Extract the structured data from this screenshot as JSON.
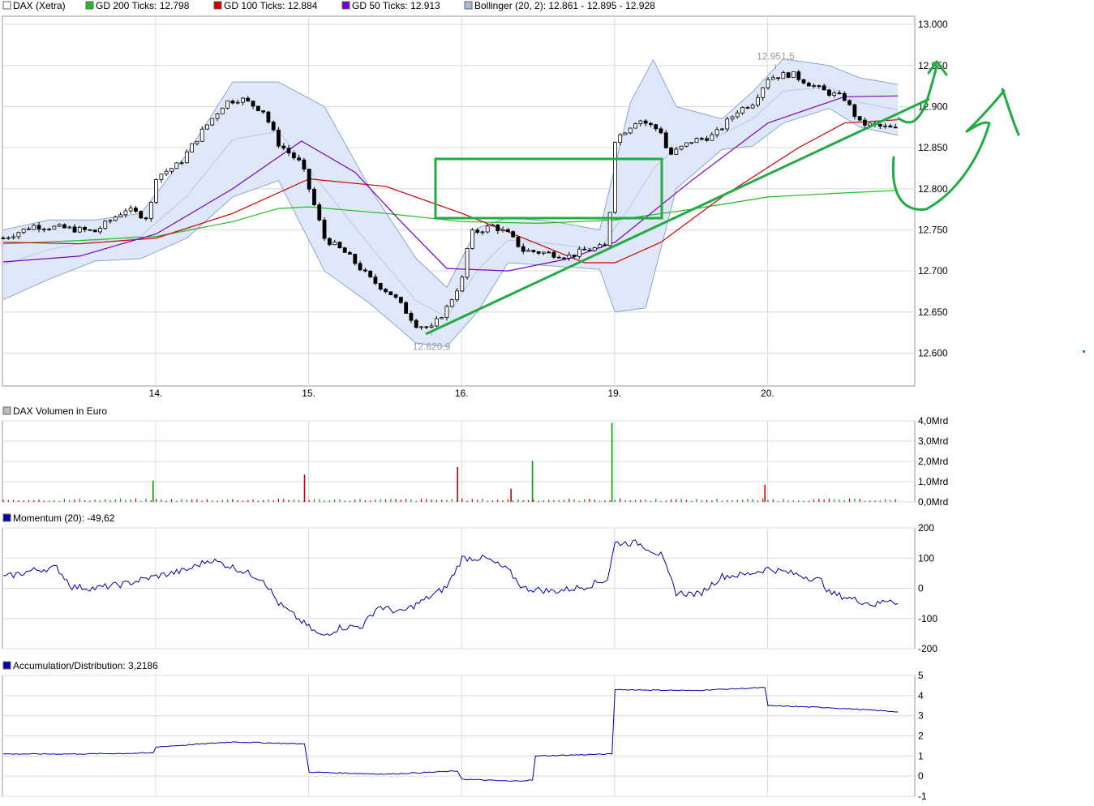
{
  "colors": {
    "up": "#00a000",
    "down": "#cc0000",
    "gd200": "#22bb22",
    "gd100": "#cc0000",
    "gd50": "#7a00cc",
    "boll_fill": "#dfe8f8",
    "boll_edge": "#8aa6d0",
    "momentum": "#0000aa",
    "ad": "#0000aa",
    "drawing": "#22aa44",
    "grid": "#dcdcdc"
  },
  "panels": {
    "price": {
      "legend": [
        {
          "label": "DAX (Xetra)",
          "color": "#ffffff"
        },
        {
          "label": "GD 200 Ticks: 12.798",
          "color": "#22bb22"
        },
        {
          "label": "GD 100 Ticks: 12.884",
          "color": "#cc0000"
        },
        {
          "label": "GD 50 Ticks: 12.913",
          "color": "#7a00cc"
        },
        {
          "label": "Bollinger (20, 2): 12.861 - 12.895 - 12.928",
          "color": "#a8bbdd"
        }
      ],
      "yticks": [
        "13.000",
        "12.950",
        "12.900",
        "12.850",
        "12.800",
        "12.750",
        "12.700",
        "12.650",
        "12.600"
      ],
      "xticks": [
        "14.",
        "15.",
        "16.",
        "19.",
        "20."
      ],
      "annotations": {
        "high": "12.951,5",
        "low": "12.620,9"
      }
    },
    "volume": {
      "legend": {
        "label": "DAX Volumen in Euro",
        "color": "#bbbbbb"
      },
      "yticks": [
        "4,0Mrd",
        "3,0Mrd",
        "2,0Mrd",
        "1,0Mrd",
        "0,0Mrd"
      ]
    },
    "momentum": {
      "legend": {
        "label": "Momentum (20): -49,62",
        "color": "#0000aa"
      },
      "yticks": [
        "200",
        "100",
        "0",
        "-100",
        "-200"
      ]
    },
    "ad": {
      "legend": {
        "label": "Accumulation/Distribution: 3,2186",
        "color": "#0000aa"
      },
      "yticks": [
        "5",
        "4",
        "3",
        "2",
        "1",
        "0",
        "-1"
      ]
    }
  },
  "chart_data": [
    {
      "type": "candlestick",
      "title": "DAX (Xetra)",
      "ylim": [
        12560,
        13010
      ],
      "x_days": [
        "14.",
        "15.",
        "16.",
        "19.",
        "20."
      ],
      "x_range": [
        0,
        6.0
      ],
      "close_path": [
        [
          0,
          12740
        ],
        [
          0.2,
          12755
        ],
        [
          0.4,
          12752
        ],
        [
          0.6,
          12748
        ],
        [
          0.8,
          12775
        ],
        [
          0.95,
          12765
        ],
        [
          1.0,
          12815
        ],
        [
          1.15,
          12830
        ],
        [
          1.3,
          12870
        ],
        [
          1.45,
          12905
        ],
        [
          1.55,
          12910
        ],
        [
          1.7,
          12895
        ],
        [
          1.8,
          12855
        ],
        [
          1.95,
          12830
        ],
        [
          2.0,
          12800
        ],
        [
          2.1,
          12740
        ],
        [
          2.25,
          12720
        ],
        [
          2.4,
          12690
        ],
        [
          2.55,
          12670
        ],
        [
          2.7,
          12635
        ],
        [
          2.8,
          12630
        ],
        [
          2.9,
          12655
        ],
        [
          3.0,
          12690
        ],
        [
          3.05,
          12745
        ],
        [
          3.2,
          12755
        ],
        [
          3.3,
          12745
        ],
        [
          3.4,
          12725
        ],
        [
          3.55,
          12722
        ],
        [
          3.7,
          12718
        ],
        [
          3.8,
          12725
        ],
        [
          3.95,
          12730
        ],
        [
          4.0,
          12860
        ],
        [
          4.15,
          12885
        ],
        [
          4.3,
          12870
        ],
        [
          4.35,
          12840
        ],
        [
          4.5,
          12858
        ],
        [
          4.65,
          12865
        ],
        [
          4.8,
          12895
        ],
        [
          4.9,
          12905
        ],
        [
          5.0,
          12935
        ],
        [
          5.15,
          12940
        ],
        [
          5.35,
          12920
        ],
        [
          5.5,
          12910
        ],
        [
          5.6,
          12880
        ],
        [
          5.75,
          12875
        ],
        [
          5.85,
          12872
        ]
      ],
      "annotations": [
        {
          "label": "12.951,5",
          "x": 5.05,
          "y": 12951.5
        },
        {
          "label": "12.620,9",
          "x": 2.8,
          "y": 12620.9
        }
      ],
      "gd200": [
        [
          0,
          12733
        ],
        [
          0.5,
          12737
        ],
        [
          1.0,
          12742
        ],
        [
          1.5,
          12760
        ],
        [
          1.8,
          12776
        ],
        [
          2.0,
          12778
        ],
        [
          2.5,
          12770
        ],
        [
          3.0,
          12760
        ],
        [
          3.5,
          12758
        ],
        [
          4.0,
          12762
        ],
        [
          4.5,
          12775
        ],
        [
          5.0,
          12790
        ],
        [
          5.5,
          12795
        ],
        [
          5.85,
          12798
        ]
      ],
      "gd100": [
        [
          0,
          12735
        ],
        [
          0.5,
          12733
        ],
        [
          1.0,
          12740
        ],
        [
          1.5,
          12770
        ],
        [
          2.0,
          12812
        ],
        [
          2.5,
          12803
        ],
        [
          3.0,
          12770
        ],
        [
          3.4,
          12740
        ],
        [
          3.8,
          12710
        ],
        [
          4.0,
          12710
        ],
        [
          4.3,
          12735
        ],
        [
          4.7,
          12790
        ],
        [
          5.2,
          12850
        ],
        [
          5.5,
          12880
        ],
        [
          5.85,
          12884
        ]
      ],
      "gd50": [
        [
          0,
          12711
        ],
        [
          0.5,
          12718
        ],
        [
          1.0,
          12745
        ],
        [
          1.5,
          12800
        ],
        [
          1.95,
          12858
        ],
        [
          2.3,
          12820
        ],
        [
          2.6,
          12760
        ],
        [
          2.9,
          12703
        ],
        [
          3.3,
          12700
        ],
        [
          3.7,
          12715
        ],
        [
          4.0,
          12735
        ],
        [
          4.5,
          12810
        ],
        [
          5.0,
          12880
        ],
        [
          5.5,
          12912
        ],
        [
          5.85,
          12913
        ]
      ],
      "bollinger_upper": [
        [
          0,
          12750
        ],
        [
          0.3,
          12762
        ],
        [
          0.6,
          12762
        ],
        [
          0.9,
          12770
        ],
        [
          1.2,
          12842
        ],
        [
          1.5,
          12930
        ],
        [
          1.8,
          12930
        ],
        [
          2.1,
          12900
        ],
        [
          2.4,
          12800
        ],
        [
          2.7,
          12715
        ],
        [
          2.9,
          12680
        ],
        [
          3.1,
          12752
        ],
        [
          3.3,
          12765
        ],
        [
          3.6,
          12760
        ],
        [
          3.9,
          12750
        ],
        [
          4.1,
          12905
        ],
        [
          4.25,
          12957
        ],
        [
          4.4,
          12900
        ],
        [
          4.7,
          12885
        ],
        [
          4.9,
          12918
        ],
        [
          5.1,
          12958
        ],
        [
          5.4,
          12950
        ],
        [
          5.6,
          12935
        ],
        [
          5.85,
          12927
        ]
      ],
      "bollinger_lower": [
        [
          0,
          12665
        ],
        [
          0.3,
          12690
        ],
        [
          0.6,
          12712
        ],
        [
          0.9,
          12715
        ],
        [
          1.2,
          12740
        ],
        [
          1.5,
          12790
        ],
        [
          1.8,
          12810
        ],
        [
          2.1,
          12700
        ],
        [
          2.4,
          12660
        ],
        [
          2.7,
          12612
        ],
        [
          2.9,
          12608
        ],
        [
          3.1,
          12650
        ],
        [
          3.3,
          12710
        ],
        [
          3.6,
          12706
        ],
        [
          3.9,
          12702
        ],
        [
          4.0,
          12650
        ],
        [
          4.2,
          12655
        ],
        [
          4.4,
          12800
        ],
        [
          4.7,
          12848
        ],
        [
          4.9,
          12852
        ],
        [
          5.1,
          12880
        ],
        [
          5.4,
          12898
        ],
        [
          5.6,
          12875
        ],
        [
          5.85,
          12865
        ]
      ]
    },
    {
      "type": "bar",
      "title": "DAX Volumen in Euro",
      "unit": "Mrd",
      "ylim": [
        0,
        4.0
      ],
      "spikes": [
        {
          "x": 0.98,
          "value": 1.05,
          "dir": "up"
        },
        {
          "x": 1.97,
          "value": 1.35,
          "dir": "down"
        },
        {
          "x": 2.97,
          "value": 1.72,
          "dir": "down"
        },
        {
          "x": 3.32,
          "value": 0.65,
          "dir": "down"
        },
        {
          "x": 3.46,
          "value": 2.03,
          "dir": "up"
        },
        {
          "x": 3.98,
          "value": 3.9,
          "dir": "up"
        },
        {
          "x": 4.98,
          "value": 0.85,
          "dir": "down"
        }
      ],
      "baseline": 0.12
    },
    {
      "type": "line",
      "title": "Momentum (20)",
      "ylim": [
        -200,
        200
      ],
      "series": [
        {
          "name": "Momentum (20)",
          "points": [
            [
              0,
              35
            ],
            [
              0.2,
              60
            ],
            [
              0.35,
              68
            ],
            [
              0.45,
              5
            ],
            [
              0.6,
              0
            ],
            [
              0.8,
              15
            ],
            [
              1.0,
              40
            ],
            [
              1.2,
              60
            ],
            [
              1.35,
              95
            ],
            [
              1.5,
              70
            ],
            [
              1.7,
              30
            ],
            [
              1.8,
              -50
            ],
            [
              1.95,
              -110
            ],
            [
              2.08,
              -160
            ],
            [
              2.2,
              -130
            ],
            [
              2.35,
              -125
            ],
            [
              2.45,
              -60
            ],
            [
              2.6,
              -80
            ],
            [
              2.75,
              -40
            ],
            [
              2.9,
              5
            ],
            [
              3.0,
              100
            ],
            [
              3.15,
              100
            ],
            [
              3.3,
              60
            ],
            [
              3.4,
              0
            ],
            [
              3.6,
              -10
            ],
            [
              3.8,
              5
            ],
            [
              3.95,
              30
            ],
            [
              4.0,
              150
            ],
            [
              4.15,
              150
            ],
            [
              4.3,
              110
            ],
            [
              4.4,
              -15
            ],
            [
              4.55,
              -20
            ],
            [
              4.7,
              40
            ],
            [
              4.85,
              45
            ],
            [
              5.0,
              65
            ],
            [
              5.2,
              45
            ],
            [
              5.35,
              25
            ],
            [
              5.4,
              -15
            ],
            [
              5.55,
              -35
            ],
            [
              5.7,
              -55
            ],
            [
              5.8,
              -35
            ],
            [
              5.85,
              -50
            ]
          ]
        }
      ]
    },
    {
      "type": "line",
      "title": "Accumulation/Distribution",
      "ylim": [
        -1,
        5
      ],
      "series": [
        {
          "name": "Accumulation/Distribution",
          "points": [
            [
              0,
              1.1
            ],
            [
              0.5,
              1.1
            ],
            [
              0.98,
              1.15
            ],
            [
              1.0,
              1.45
            ],
            [
              1.5,
              1.7
            ],
            [
              1.97,
              1.6
            ],
            [
              2.0,
              0.2
            ],
            [
              2.5,
              0.1
            ],
            [
              2.97,
              0.25
            ],
            [
              3.0,
              -0.15
            ],
            [
              3.32,
              -0.25
            ],
            [
              3.46,
              -0.2
            ],
            [
              3.48,
              1.0
            ],
            [
              3.98,
              1.1
            ],
            [
              4.0,
              4.3
            ],
            [
              4.5,
              4.25
            ],
            [
              4.98,
              4.4
            ],
            [
              5.0,
              3.5
            ],
            [
              5.4,
              3.4
            ],
            [
              5.85,
              3.2
            ]
          ]
        }
      ]
    }
  ]
}
